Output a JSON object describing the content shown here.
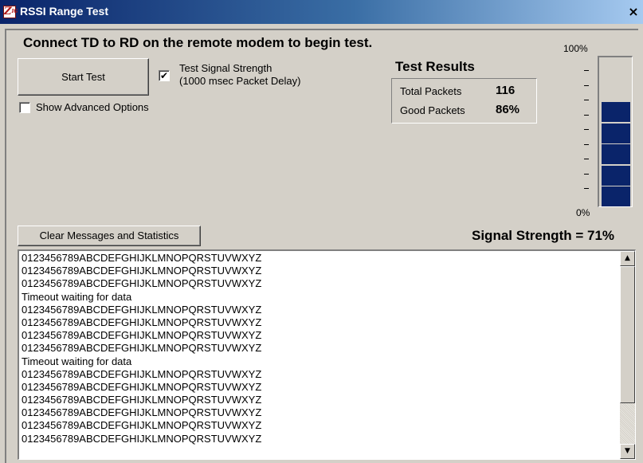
{
  "window": {
    "title": "RSSI Range Test",
    "icon_name": "app-logo-icon",
    "close_label": "×"
  },
  "instruction": "Connect TD to RD on the remote modem to begin test.",
  "controls": {
    "start_label": "Start Test",
    "signal_checkbox_line1": "Test Signal Strength",
    "signal_checkbox_line2": "(1000 msec Packet Delay)",
    "signal_checked": true,
    "signal_check_mark": "✔",
    "advanced_label": "Show Advanced Options",
    "advanced_checked": false,
    "clear_label": "Clear Messages and Statistics"
  },
  "results": {
    "title": "Test Results",
    "total_label": "Total Packets",
    "total_value": "116",
    "good_label": "Good Packets",
    "good_value": "86%"
  },
  "meter": {
    "top_label": "100%",
    "bottom_label": "0%",
    "segments_total": 7,
    "segments_filled": 5,
    "fill_color": "#0a246a"
  },
  "signal_strength_text": "Signal Strength = 71%",
  "log_lines": [
    "0123456789ABCDEFGHIJKLMNOPQRSTUVWXYZ",
    "0123456789ABCDEFGHIJKLMNOPQRSTUVWXYZ",
    "0123456789ABCDEFGHIJKLMNOPQRSTUVWXYZ",
    "Timeout waiting for data",
    "0123456789ABCDEFGHIJKLMNOPQRSTUVWXYZ",
    "0123456789ABCDEFGHIJKLMNOPQRSTUVWXYZ",
    "0123456789ABCDEFGHIJKLMNOPQRSTUVWXYZ",
    "0123456789ABCDEFGHIJKLMNOPQRSTUVWXYZ",
    "Timeout waiting for data",
    "0123456789ABCDEFGHIJKLMNOPQRSTUVWXYZ",
    "0123456789ABCDEFGHIJKLMNOPQRSTUVWXYZ",
    "0123456789ABCDEFGHIJKLMNOPQRSTUVWXYZ",
    "0123456789ABCDEFGHIJKLMNOPQRSTUVWXYZ",
    "0123456789ABCDEFGHIJKLMNOPQRSTUVWXYZ",
    "0123456789ABCDEFGHIJKLMNOPQRSTUVWXYZ"
  ],
  "scrollbar": {
    "up_arrow": "▲",
    "down_arrow": "▼"
  }
}
